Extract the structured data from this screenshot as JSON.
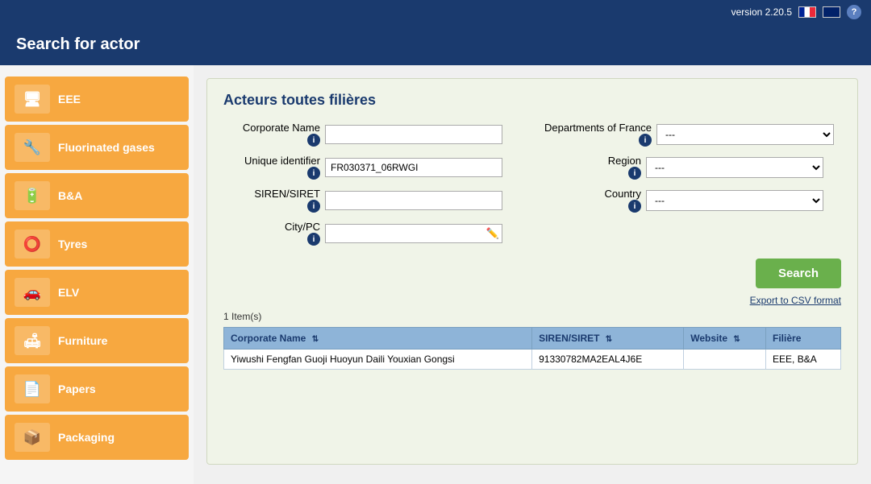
{
  "topbar": {
    "version": "version 2.20.5",
    "help_label": "?"
  },
  "header": {
    "title": "Search for actor"
  },
  "sidebar": {
    "items": [
      {
        "id": "eee",
        "label": "EEE",
        "icon": "🖥"
      },
      {
        "id": "fluorinated",
        "label": "Fluorinated gases",
        "icon": "🔧"
      },
      {
        "id": "ba",
        "label": "B&A",
        "icon": "🔋"
      },
      {
        "id": "tyres",
        "label": "Tyres",
        "icon": "⭕"
      },
      {
        "id": "elv",
        "label": "ELV",
        "icon": "🚗"
      },
      {
        "id": "furniture",
        "label": "Furniture",
        "icon": "🛋"
      },
      {
        "id": "papers",
        "label": "Papers",
        "icon": "📄"
      },
      {
        "id": "packaging",
        "label": "Packaging",
        "icon": "📦"
      }
    ]
  },
  "panel": {
    "title": "Acteurs toutes filières",
    "form": {
      "corporate_name_label": "Corporate Name",
      "unique_id_label": "Unique identifier",
      "siren_label": "SIREN/SIRET",
      "citypc_label": "City/PC",
      "departments_label": "Departments of France",
      "region_label": "Region",
      "country_label": "Country",
      "unique_id_value": "FR030371_06RWGI",
      "corporate_name_placeholder": "",
      "siren_placeholder": "",
      "citypc_placeholder": "",
      "dept_default": "---",
      "region_default": "---",
      "country_default": "---"
    },
    "search_button": "Search",
    "export_link": "Export to CSV format",
    "results_count": "1 Item(s)",
    "table": {
      "columns": [
        "Corporate Name",
        "SIREN/SIRET",
        "Website",
        "Filière"
      ],
      "rows": [
        {
          "corporate_name": "Yiwushi Fengfan Guoji Huoyun Daili Youxian Gongsi",
          "siren": "91330782MA2EAL4J6E",
          "website": "",
          "filiere": "EEE, B&A"
        }
      ]
    }
  }
}
